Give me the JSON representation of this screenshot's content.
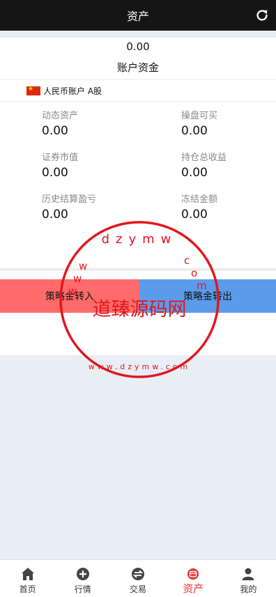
{
  "header": {
    "title": "资产",
    "refresh_icon": "refresh-icon"
  },
  "summary": {
    "balance": "0.00",
    "balance_label": "账户资金"
  },
  "account": {
    "flag_icon": "china-flag-icon",
    "name": "人民币账户 A股"
  },
  "stats": [
    {
      "label": "动态资产",
      "value": "0.00"
    },
    {
      "label": "操盘可买",
      "value": "0.00"
    },
    {
      "label": "证券市值",
      "value": "0.00"
    },
    {
      "label": "持仓总收益",
      "value": "0.00"
    },
    {
      "label": "历史结算盈亏",
      "value": "0.00"
    },
    {
      "label": "冻结金额",
      "value": "0.00"
    }
  ],
  "actions": {
    "transfer_in": "策略金转入",
    "transfer_out": "策略金转出"
  },
  "colors": {
    "header_bg": "#151515",
    "transfer_in_bg": "#ff6b6b",
    "transfer_out_bg": "#5b9cea",
    "active_tab": "#e8363a",
    "stamp": "#e3161c"
  },
  "watermark": {
    "name": "道臻源码网",
    "url_top": "dzymw",
    "url_ring": "www.dzymw.com"
  },
  "tabbar": [
    {
      "label": "首页",
      "icon": "home-icon"
    },
    {
      "label": "行情",
      "icon": "plus-circle-icon"
    },
    {
      "label": "交易",
      "icon": "exchange-icon"
    },
    {
      "label": "资产",
      "icon": "wallet-icon",
      "active": true
    },
    {
      "label": "我的",
      "icon": "user-icon"
    }
  ]
}
